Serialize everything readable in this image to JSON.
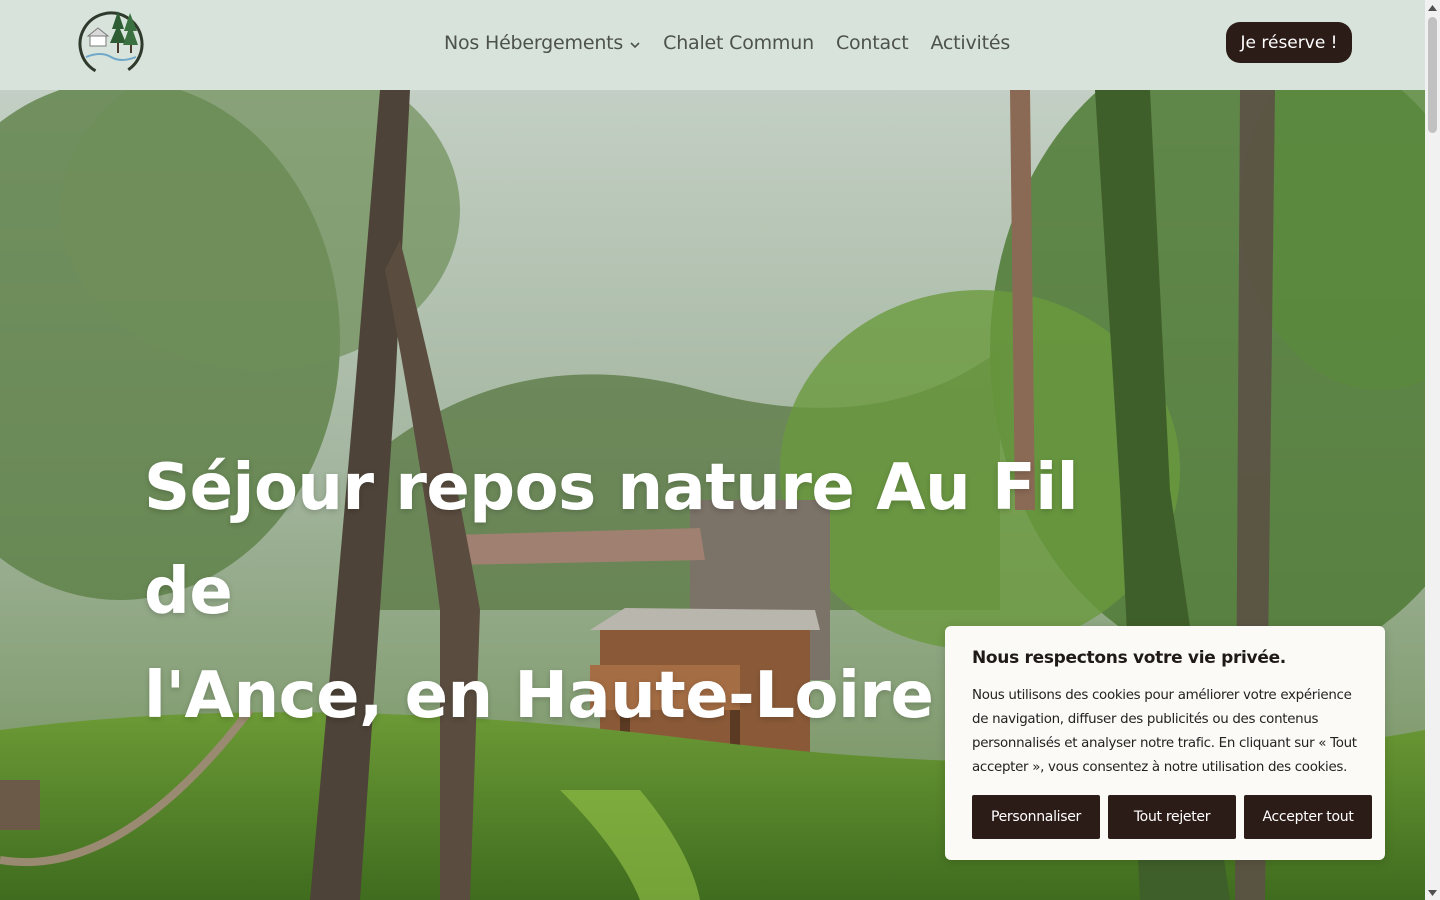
{
  "header": {
    "logo_alt": "logo",
    "nav": [
      {
        "label": "Nos Hébergements",
        "has_dropdown": true
      },
      {
        "label": "Chalet Commun"
      },
      {
        "label": "Contact"
      },
      {
        "label": "Activités"
      }
    ],
    "reserve_label": "Je réserve !"
  },
  "hero": {
    "title_line1": "Séjour repos nature Au Fil de",
    "title_line2": "l'Ance, en Haute-Loire"
  },
  "cookie_banner": {
    "title": "Nous respectons votre vie privée.",
    "text": "Nous utilisons des cookies pour améliorer votre expérience de navigation, diffuser des publicités ou des contenus personnalisés et analyser notre trafic. En cliquant sur « Tout accepter », vous consentez à notre utilisation des cookies.",
    "buttons": {
      "customize": "Personnaliser",
      "reject": "Tout rejeter",
      "accept": "Accepter tout"
    }
  },
  "colors": {
    "header_bg": "#d8e4db",
    "button_dark": "#2c1c18",
    "nav_text": "#4d524c"
  }
}
